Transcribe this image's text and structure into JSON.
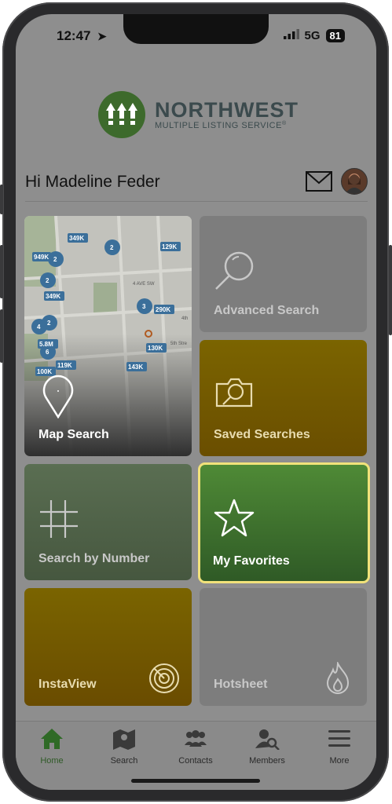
{
  "status": {
    "time": "12:47",
    "network": "5G",
    "battery": "81"
  },
  "brand": {
    "name": "NORTHWEST",
    "tagline": "MULTIPLE LISTING SERVICE",
    "tagline_mark": "®"
  },
  "greeting": "Hi Madeline Feder",
  "tiles": [
    {
      "label": "Map Search",
      "icon": "map-pin-icon"
    },
    {
      "label": "Advanced Search",
      "icon": "magnifier-icon"
    },
    {
      "label": "Saved Searches",
      "icon": "saved-search-icon"
    },
    {
      "label": "Search by Number",
      "icon": "hashtag-icon"
    },
    {
      "label": "My Favorites",
      "icon": "star-icon"
    },
    {
      "label": "InstaView",
      "icon": "radar-icon"
    },
    {
      "label": "Hotsheet",
      "icon": "flame-icon"
    }
  ],
  "map_labels": {
    "prices": [
      "349K",
      "129K",
      "949K",
      "349K",
      "290K",
      "130K",
      "5.8M",
      "119K",
      "143K",
      "100K"
    ],
    "clusters": [
      "2",
      "2",
      "2",
      "3",
      "4",
      "2",
      "6"
    ],
    "streets": [
      "4 AVE SW",
      "4th",
      "5th Stre"
    ]
  },
  "tabs": [
    {
      "label": "Home",
      "icon": "home-icon",
      "active": true
    },
    {
      "label": "Search",
      "icon": "map-icon"
    },
    {
      "label": "Contacts",
      "icon": "contacts-icon"
    },
    {
      "label": "Members",
      "icon": "member-search-icon"
    },
    {
      "label": "More",
      "icon": "menu-icon"
    }
  ],
  "colors": {
    "green": "#3d6a2c",
    "gold": "#7a6200",
    "highlight": "#f1e27a"
  }
}
